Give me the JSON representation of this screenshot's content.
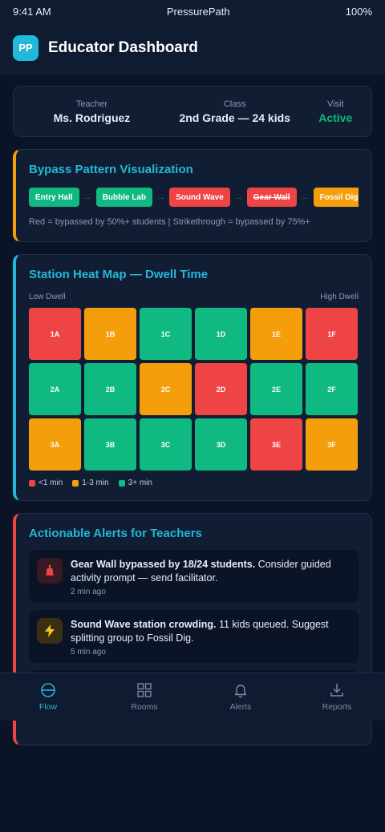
{
  "status_bar": {
    "time": "9:41 AM",
    "app_name": "PressurePath",
    "battery": "100%"
  },
  "header": {
    "logo_text": "PP",
    "title": "Educator Dashboard"
  },
  "info": {
    "teacher_label": "Teacher",
    "teacher_value": "Ms. Rodriguez",
    "class_label": "Class",
    "class_value": "2nd Grade — 24 kids",
    "visit_label": "Visit",
    "visit_value": "Active"
  },
  "bypass": {
    "title": "Bypass Pattern Visualization",
    "stations": [
      {
        "label": "Entry Hall",
        "status": "green"
      },
      {
        "label": "Bubble Lab",
        "status": "green"
      },
      {
        "label": "Sound Wave",
        "status": "red"
      },
      {
        "label": "Gear Wall",
        "status": "red-strike"
      },
      {
        "label": "Fossil Dig",
        "status": "orange"
      }
    ],
    "note": "Red = bypassed by 50%+ students | Strikethrough = bypassed by 75%+"
  },
  "heatmap": {
    "title": "Station Heat Map — Dwell Time",
    "low_label": "Low Dwell",
    "high_label": "High Dwell",
    "cells": [
      {
        "id": "1A",
        "level": "red"
      },
      {
        "id": "1B",
        "level": "orange"
      },
      {
        "id": "1C",
        "level": "green"
      },
      {
        "id": "1D",
        "level": "green"
      },
      {
        "id": "1E",
        "level": "orange"
      },
      {
        "id": "1F",
        "level": "red"
      },
      {
        "id": "2A",
        "level": "green"
      },
      {
        "id": "2B",
        "level": "green"
      },
      {
        "id": "2C",
        "level": "orange"
      },
      {
        "id": "2D",
        "level": "red"
      },
      {
        "id": "2E",
        "level": "green"
      },
      {
        "id": "2F",
        "level": "green"
      },
      {
        "id": "3A",
        "level": "orange"
      },
      {
        "id": "3B",
        "level": "green"
      },
      {
        "id": "3C",
        "level": "green"
      },
      {
        "id": "3D",
        "level": "green"
      },
      {
        "id": "3E",
        "level": "red"
      },
      {
        "id": "3F",
        "level": "orange"
      }
    ],
    "legend": [
      {
        "label": "<1 min",
        "color": "#ef4444"
      },
      {
        "label": "1-3 min",
        "color": "#f59e0b"
      },
      {
        "label": "3+ min",
        "color": "#10b981"
      }
    ]
  },
  "alerts": {
    "title": "Actionable Alerts for Teachers",
    "items": [
      {
        "icon": "siren-icon",
        "bold": "Gear Wall bypassed by 18/24 students.",
        "text": " Consider guided activity prompt — send facilitator.",
        "time": "2 min ago"
      },
      {
        "icon": "lightning-icon",
        "bold": "Sound Wave station crowding.",
        "text": " 11 kids queued. Suggest splitting group to Fossil Dig.",
        "time": "5 min ago"
      }
    ]
  },
  "tabs": [
    {
      "label": "Flow",
      "icon": "flow-icon",
      "active": true
    },
    {
      "label": "Rooms",
      "icon": "grid-icon",
      "active": false
    },
    {
      "label": "Alerts",
      "icon": "bell-icon",
      "active": false
    },
    {
      "label": "Reports",
      "icon": "download-icon",
      "active": false
    }
  ],
  "colors": {
    "accent": "#22b8d8",
    "green": "#10b981",
    "orange": "#f59e0b",
    "red": "#ef4444",
    "background": "#0b1426"
  }
}
